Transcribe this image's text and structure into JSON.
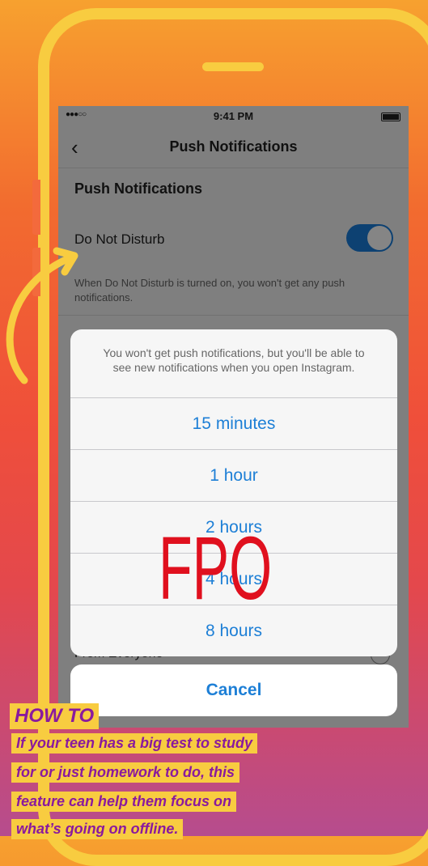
{
  "status_bar": {
    "signal": "●●●○○",
    "time": "9:41 PM"
  },
  "nav": {
    "back": "‹",
    "title": "Push Notifications"
  },
  "section": {
    "title": "Push Notifications"
  },
  "dnd": {
    "label": "Do Not Disturb",
    "enabled": true,
    "description": "When Do Not Disturb is turned on, you won't get any push notifications."
  },
  "background_row": {
    "label": "From Everyone"
  },
  "sheet": {
    "message": "You won't get push notifications, but you'll be able to see new notifications when you open Instagram.",
    "options": [
      "15 minutes",
      "1 hour",
      "2 hours",
      "4 hours",
      "8 hours"
    ],
    "cancel": "Cancel"
  },
  "overlay": {
    "watermark": "FPO"
  },
  "howto": {
    "title": "HOW TO",
    "lines": [
      "If your teen has a big test to study",
      "for or just homework to do, this",
      "feature can help them focus on",
      "what’s going on offline."
    ]
  },
  "colors": {
    "accent": "#1d7fd6",
    "highlight": "#f8cc40",
    "howto_text": "#8a1a9e",
    "fpo": "#e0101e"
  }
}
